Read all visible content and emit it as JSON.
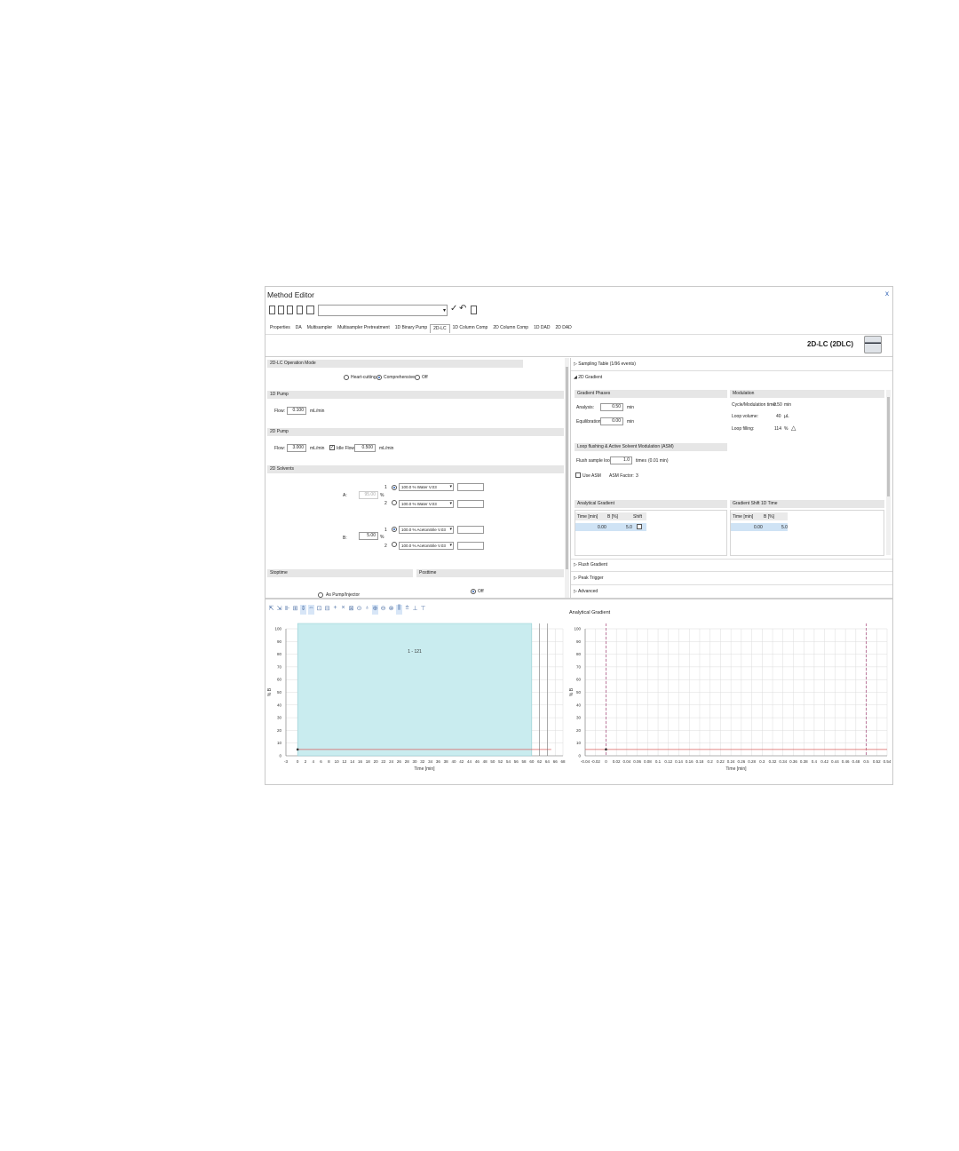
{
  "window": {
    "title": "Method Editor",
    "close": "x"
  },
  "toolbar": {
    "undo": "↶",
    "apply": "✓",
    "save": "⎙"
  },
  "tabs": [
    "Properties",
    "DA",
    "Multisampler",
    "Multisampler Pretreatment",
    "1D Binary Pump",
    "2D-LC",
    "1D Column Comp",
    "2D Column Comp",
    "1D DAD",
    "2D DAD"
  ],
  "module": {
    "title": "2D-LC (2DLC)"
  },
  "left": {
    "op_mode": {
      "header": "2D-LC Operation Mode",
      "options": [
        "Heart-cutting",
        "Comprehensive",
        "Off"
      ],
      "selected": "Comprehensive"
    },
    "pump1": {
      "header": "1D Pump",
      "flow_label": "Flow:",
      "flow_value": "0.100",
      "unit": "mL/min"
    },
    "pump2": {
      "header": "2D Pump",
      "flow_label": "Flow:",
      "flow_value": "3.000",
      "unit": "mL/min",
      "idle_label": "Idle Flow:",
      "idle_value": "0.500",
      "idle_unit": "mL/min"
    },
    "solvents": {
      "header": "2D Solvents",
      "a_label": "A:",
      "a_value": "95.00",
      "a_unit": "%",
      "a1": "100.0 % Water V.03",
      "a2": "100.0 % Water V.03",
      "b_label": "B:",
      "b_value": "5.00",
      "b_unit": "%",
      "b1": "100.0 % Acetonitrile V.03",
      "b2": "100.0 % Acetonitrile V.03",
      "ch1": "1",
      "ch2": "2"
    },
    "stoptime": {
      "header": "Stoptime",
      "option": "As Pump/Injector"
    },
    "posttime": {
      "header": "Posttime",
      "option": "Off"
    }
  },
  "right": {
    "sampling_table": "Sampling Table (1/96 events)",
    "gradient_2d": "2D Gradient",
    "gradient_phases": {
      "header": "Gradient Phases",
      "analysis_label": "Analysis:",
      "analysis_value": "0.50",
      "analysis_unit": "min",
      "equil_label": "Equilibration:",
      "equil_value": "0.00",
      "equil_unit": "min"
    },
    "modulation": {
      "header": "Modulation",
      "cycle_label": "Cycle/Modulation time:",
      "cycle_value": "0.50",
      "cycle_unit": "min",
      "loop_vol_label": "Loop volume:",
      "loop_vol_value": "40",
      "loop_vol_unit": "µL",
      "loop_fill_label": "Loop filling:",
      "loop_fill_value": "114",
      "loop_fill_unit": "%"
    },
    "loop_flushing": {
      "header": "Loop flushing & Active Solvent Modulation (ASM)",
      "flush_label": "Flush sample loop",
      "flush_value": "1.0",
      "flush_unit": "times",
      "flush_time": "(0.01 min)",
      "use_asm": "Use ASM",
      "asm_factor_label": "ASM Factor:",
      "asm_factor_value": "3"
    },
    "analytical": {
      "header": "Analytical Gradient",
      "cols": [
        "Time [min]",
        "B [%]",
        "Shift"
      ],
      "row": [
        "0.00",
        "5.0",
        ""
      ]
    },
    "shift": {
      "header": "Gradient Shift 1D Time",
      "cols": [
        "Time [min]",
        "B [%]"
      ],
      "row": [
        "0.00",
        "5.0"
      ]
    },
    "collapsed": [
      "Flush Gradient",
      "Peak Trigger",
      "Advanced"
    ]
  },
  "chart_data": [
    {
      "type": "area",
      "title": "",
      "xlabel": "Time [min]",
      "ylabel": "% B",
      "xlim": [
        -3,
        68
      ],
      "ylim": [
        0,
        100
      ],
      "x_ticks": [
        -3,
        0,
        2,
        4,
        6,
        8,
        10,
        12,
        14,
        16,
        18,
        20,
        22,
        24,
        26,
        28,
        30,
        32,
        34,
        36,
        38,
        40,
        42,
        44,
        46,
        48,
        50,
        52,
        54,
        56,
        58,
        60,
        62,
        64,
        66,
        68
      ],
      "y_ticks": [
        0,
        10,
        20,
        30,
        40,
        50,
        60,
        70,
        80,
        90,
        100
      ],
      "region": {
        "label": "1 - 121",
        "x_start": 0,
        "x_end": 60
      },
      "series": [
        {
          "x": [
            0,
            65
          ],
          "y": [
            5,
            5
          ]
        }
      ],
      "grid": true
    },
    {
      "type": "line",
      "title": "Analytical Gradient",
      "xlabel": "Time [min]",
      "ylabel": "% B",
      "xlim": [
        -0.04,
        0.54
      ],
      "ylim": [
        0,
        100
      ],
      "x_ticks": [
        "-0.04",
        "-0.02",
        "0",
        "0.02",
        "0.04",
        "0.06",
        "0.08",
        "0.1",
        "0.12",
        "0.14",
        "0.16",
        "0.18",
        "0.2",
        "0.22",
        "0.24",
        "0.26",
        "0.28",
        "0.3",
        "0.32",
        "0.34",
        "0.36",
        "0.38",
        "0.4",
        "0.42",
        "0.44",
        "0.46",
        "0.48",
        "0.5",
        "0.52",
        "0.54"
      ],
      "y_ticks": [
        0,
        10,
        20,
        30,
        40,
        50,
        60,
        70,
        80,
        90,
        100
      ],
      "markers_x": [
        0,
        0.5
      ],
      "series": [
        {
          "x": [
            -0.04,
            0.54
          ],
          "y": [
            5,
            5
          ]
        }
      ],
      "grid": true
    }
  ],
  "colors": {
    "accent": "#2b5fb3",
    "region": "#c9ecef",
    "line": "#d9605f",
    "grid": "#dcdcdc",
    "section": "#e6e6e6"
  }
}
